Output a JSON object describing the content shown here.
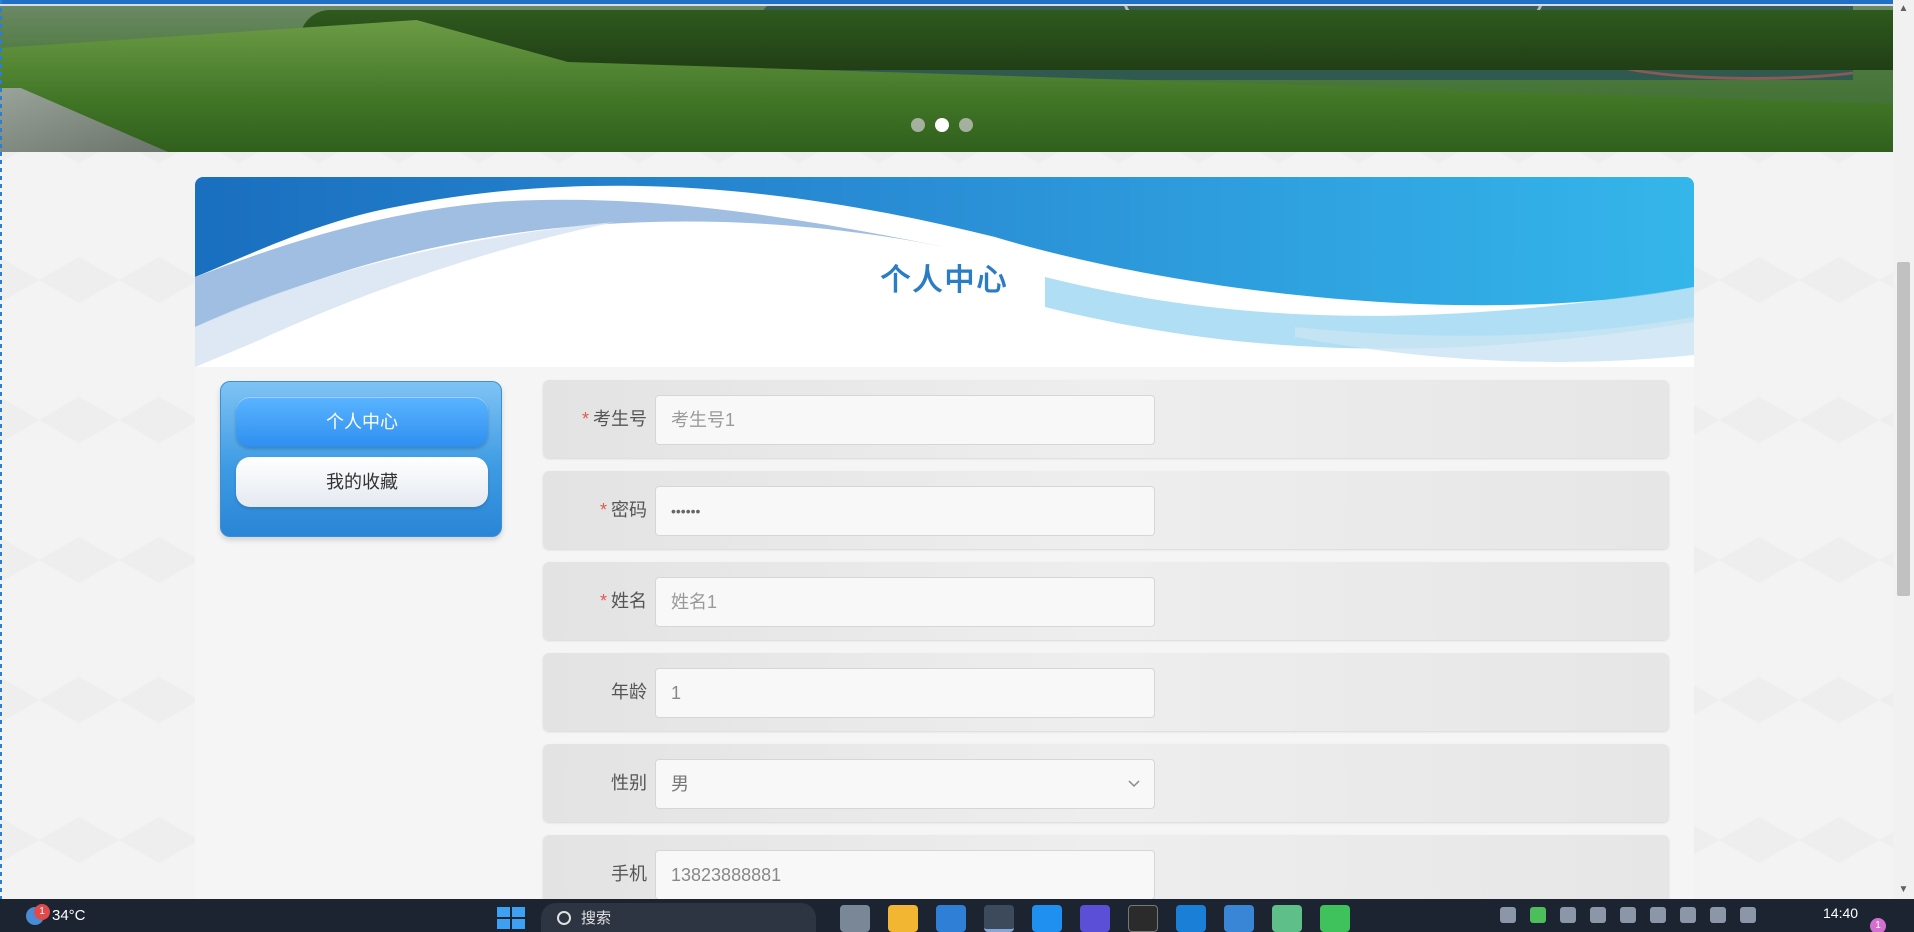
{
  "banner": {
    "carousel_dots": 3,
    "active_dot": 1
  },
  "page": {
    "title": "个人中心"
  },
  "side_menu": {
    "items": [
      {
        "label": "个人中心",
        "active": true
      },
      {
        "label": "我的收藏",
        "active": false
      }
    ]
  },
  "form": {
    "fields": [
      {
        "label": "考生号",
        "required": true,
        "type": "text",
        "placeholder": "考生号1",
        "value": ""
      },
      {
        "label": "密码",
        "required": true,
        "type": "password",
        "placeholder": "",
        "value": "••••••"
      },
      {
        "label": "姓名",
        "required": true,
        "type": "text",
        "placeholder": "姓名1",
        "value": ""
      },
      {
        "label": "年龄",
        "required": false,
        "type": "text",
        "placeholder": "",
        "value": "1"
      },
      {
        "label": "性别",
        "required": false,
        "type": "select",
        "placeholder": "",
        "value": "男"
      },
      {
        "label": "手机",
        "required": false,
        "type": "text",
        "placeholder": "",
        "value": "13823888881"
      }
    ],
    "required_mark": "*"
  },
  "taskbar": {
    "weather_temp": "34°C",
    "weather_badge": "1",
    "search_label": "搜索",
    "clock": "14:40",
    "notification_count": "1"
  },
  "colors": {
    "title": "#2a7cc6",
    "required": "#e4574f",
    "menu_active": "#2f8ff0"
  }
}
